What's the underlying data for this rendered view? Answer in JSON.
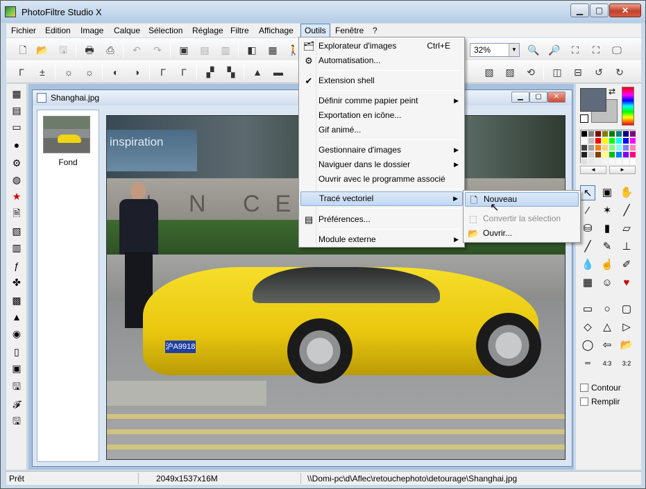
{
  "window": {
    "title": "PhotoFiltre Studio X"
  },
  "menubar": [
    "Fichier",
    "Edition",
    "Image",
    "Calque",
    "Sélection",
    "Réglage",
    "Filtre",
    "Affichage",
    "Outils",
    "Fenêtre",
    "?"
  ],
  "toolbar": {
    "zoom": "32%"
  },
  "document": {
    "title": "Shanghai.jpg",
    "layer_name": "Fond",
    "photo_text_banner": "inspiration",
    "photo_text_wall": "N  N  CEN",
    "plate": "沪A9918"
  },
  "outils_menu": {
    "items": [
      {
        "label": "Explorateur d'images",
        "shortcut": "Ctrl+E"
      },
      {
        "label": "Automatisation..."
      },
      {
        "label": "Extension shell"
      },
      {
        "label": "Définir comme papier peint"
      },
      {
        "label": "Exportation en icône..."
      },
      {
        "label": "Gif animé..."
      },
      {
        "label": "Gestionnaire d'images"
      },
      {
        "label": "Naviguer dans le dossier"
      },
      {
        "label": "Ouvrir avec le programme associé"
      },
      {
        "label": "Tracé vectoriel"
      },
      {
        "label": "Préférences..."
      },
      {
        "label": "Module externe"
      }
    ]
  },
  "submenu": {
    "items": [
      {
        "label": "Nouveau"
      },
      {
        "label": "Convertir la sélection"
      },
      {
        "label": "Ouvrir..."
      }
    ]
  },
  "right_panel": {
    "contour_label": "Contour",
    "remplir_label": "Remplir"
  },
  "statusbar": {
    "state": "Prêt",
    "image_info": "2049x1537x16M",
    "path": "\\\\Domi-pc\\d\\Aflec\\retouchephoto\\detourage\\Shanghai.jpg"
  },
  "colors": {
    "foreground": "#5f6b7a",
    "background": "#c0c0c0",
    "menu_highlight": "#c2d8f2"
  }
}
